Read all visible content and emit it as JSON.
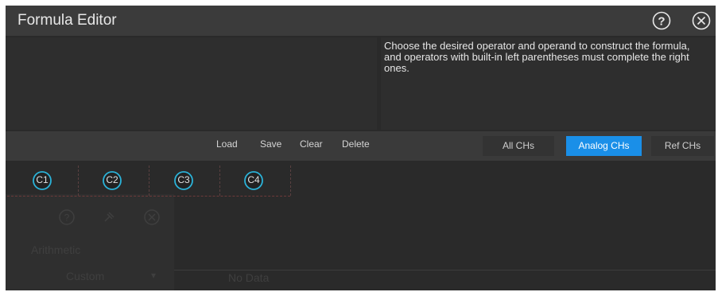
{
  "dialog": {
    "title": "Formula Editor",
    "help_icon": "help-circle-icon",
    "close_icon": "close-circle-icon"
  },
  "hint": {
    "text": "Choose the desired operator and operand to construct the formula, and operators with built-in left parentheses must complete the right ones."
  },
  "formula": {
    "value": ""
  },
  "toolbar": {
    "load": "Load",
    "save": "Save",
    "clear": "Clear",
    "delete": "Delete"
  },
  "channel_tabs": [
    {
      "label": "All CHs",
      "active": false
    },
    {
      "label": "Analog CHs",
      "active": true
    },
    {
      "label": "Ref CHs",
      "active": false
    }
  ],
  "operands": [
    "C1",
    "C2",
    "C3",
    "C4"
  ],
  "colors": {
    "accent": "#1a8fe8",
    "operand_ring": "#2bb3d9",
    "background": "#2a2a2a",
    "titlebar": "#3b3b3b"
  },
  "ghost": {
    "mode_label": "Arithmetic",
    "mode_value": "Custom",
    "underlay_text": "No Data"
  }
}
